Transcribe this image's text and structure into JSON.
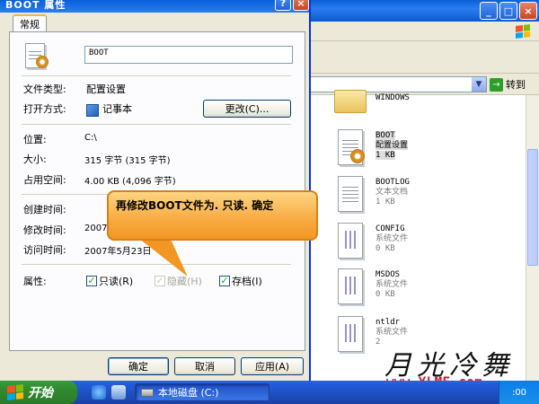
{
  "dialog": {
    "title": "BOOT 属性",
    "help_label": "?",
    "close_label": "×",
    "tab_label": "常规",
    "filename": "BOOT",
    "type_label": "文件类型:",
    "type_value": "配置设置",
    "opens_with_label": "打开方式:",
    "opens_with_value": "记事本",
    "change_button": "更改(C)...",
    "location_label": "位置:",
    "location_value": "C:\\",
    "size_label": "大小:",
    "size_value": "315 字节 (315 字节)",
    "size_on_disk_label": "占用空间:",
    "size_on_disk_value": "4.00 KB (4,096 字节)",
    "created_label": "创建时间:",
    "modified_label": "修改时间:",
    "modified_value": "2007",
    "accessed_label": "访问时间:",
    "accessed_value": "2007年5月23日",
    "attributes_label": "属性:",
    "readonly_label": "只读(R)",
    "readonly_checked": true,
    "hidden_label": "隐藏(H)",
    "hidden_checked": true,
    "archive_label": "存档(I)",
    "archive_checked": true,
    "ok_button": "确定",
    "cancel_button": "取消",
    "apply_button": "应用(A)"
  },
  "callout": {
    "text": "再修改BOOT文件为. 只读. 确定"
  },
  "explorer": {
    "minimize_label": "_",
    "maximize_label": "□",
    "close_label": "×",
    "go_label": "转到",
    "go_arrow": "→",
    "dropdown_arrow": "▼",
    "files": [
      {
        "name": "WINDOWS",
        "type": "",
        "size": ""
      },
      {
        "name": "BOOT",
        "type": "配置设置",
        "size": "1 KB"
      },
      {
        "name": "BOOTLOG",
        "type": "文本文档",
        "size": "1 KB"
      },
      {
        "name": "CONFIG",
        "type": "系统文件",
        "size": "0 KB"
      },
      {
        "name": "MSDOS",
        "type": "系统文件",
        "size": "0 KB"
      },
      {
        "name": "ntldr",
        "type": "系统文件",
        "size": "2"
      }
    ]
  },
  "watermark": {
    "calligraphy": "月光冷舞",
    "url": "www.YLMF.com"
  },
  "taskbar": {
    "start_label": "开始",
    "task_label": "本地磁盘 (C:)",
    "clock": ":00"
  },
  "colors": {
    "xp_title_blue": "#0a5fd8",
    "callout_orange": "#f7a940",
    "watermark_red": "#e0141a",
    "start_green": "#3c9a3c"
  }
}
